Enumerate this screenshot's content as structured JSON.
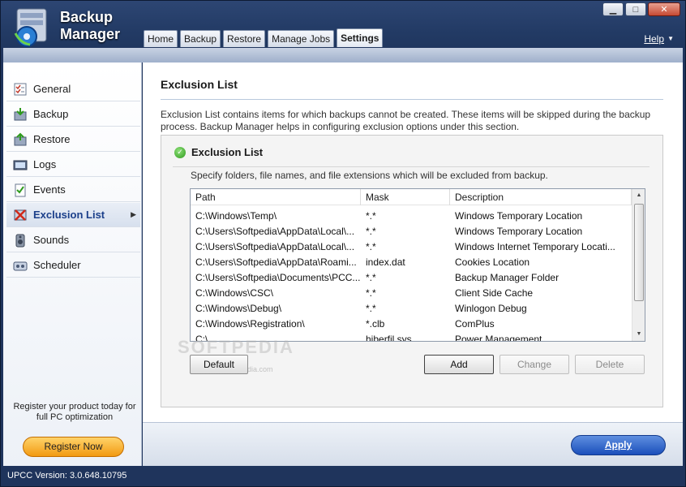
{
  "app": {
    "title_line1": "Backup",
    "title_line2": "Manager"
  },
  "window_controls": {
    "minimize": "▁",
    "maximize": "□",
    "close": "✕"
  },
  "tabs": [
    {
      "label": "Home",
      "active": false
    },
    {
      "label": "Backup",
      "active": false
    },
    {
      "label": "Restore",
      "active": false
    },
    {
      "label": "Manage Jobs",
      "active": false
    },
    {
      "label": "Settings",
      "active": true
    }
  ],
  "help": {
    "label": "Help",
    "arrow": "▼"
  },
  "sidebar": {
    "items": [
      {
        "label": "General",
        "icon": "general-icon",
        "active": false
      },
      {
        "label": "Backup",
        "icon": "backup-icon",
        "active": false
      },
      {
        "label": "Restore",
        "icon": "restore-icon",
        "active": false
      },
      {
        "label": "Logs",
        "icon": "logs-icon",
        "active": false
      },
      {
        "label": "Events",
        "icon": "events-icon",
        "active": false
      },
      {
        "label": "Exclusion List",
        "icon": "exclusion-icon",
        "active": true
      },
      {
        "label": "Sounds",
        "icon": "sounds-icon",
        "active": false
      },
      {
        "label": "Scheduler",
        "icon": "scheduler-icon",
        "active": false
      }
    ],
    "register_text": "Register your product today for full PC optimization",
    "register_button": "Register Now"
  },
  "main": {
    "title": "Exclusion List",
    "description": "Exclusion List contains items for which backups cannot be created. These items will be skipped during the backup process. Backup Manager helps in configuring exclusion options under this section.",
    "group": {
      "title": "Exclusion List",
      "description": "Specify folders, file names, and file extensions which will be excluded from backup.",
      "columns": [
        "Path",
        "Mask",
        "Description"
      ],
      "rows": [
        [
          "C:\\Windows\\Temp\\",
          "*.*",
          "Windows Temporary Location"
        ],
        [
          "C:\\Users\\Softpedia\\AppData\\Local\\...",
          "*.*",
          "Windows Temporary Location"
        ],
        [
          "C:\\Users\\Softpedia\\AppData\\Local\\...",
          "*.*",
          "Windows Internet Temporary Locati..."
        ],
        [
          "C:\\Users\\Softpedia\\AppData\\Roami...",
          "index.dat",
          "Cookies Location"
        ],
        [
          "C:\\Users\\Softpedia\\Documents\\PCC...",
          "*.*",
          "Backup Manager Folder"
        ],
        [
          "C:\\Windows\\CSC\\",
          "*.*",
          "Client Side Cache"
        ],
        [
          "C:\\Windows\\Debug\\",
          "*.*",
          "Winlogon Debug"
        ],
        [
          "C:\\Windows\\Registration\\",
          "*.clb",
          "ComPlus"
        ],
        [
          "C:\\",
          "hiberfil.sys",
          "Power Management"
        ]
      ],
      "buttons": {
        "default": "Default",
        "add": "Add",
        "change": "Change",
        "delete": "Delete"
      },
      "watermark": "SOFTPEDIA",
      "watermark_sub": "www.softpedia.com"
    },
    "apply_button": "Apply"
  },
  "status": {
    "version": "UPCC Version: 3.0.648.10795"
  },
  "colors": {
    "frame": "#223a64",
    "accent": "#1b3f8a",
    "apply": "#1b4fbb",
    "register": "#f29a12"
  }
}
